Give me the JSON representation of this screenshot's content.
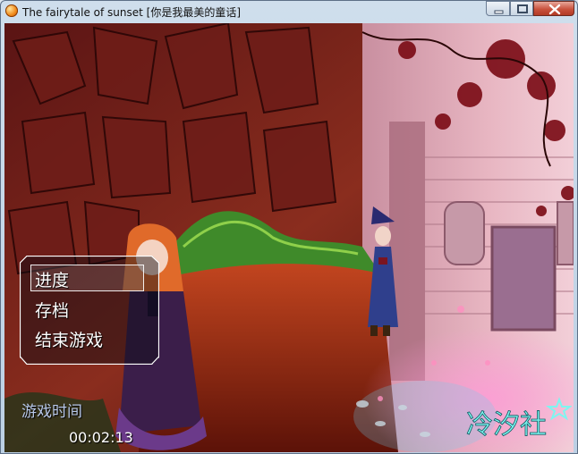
{
  "window": {
    "title": "The fairytale of sunset [你是我最美的童话]",
    "buttons": [
      "minimize",
      "maximize",
      "close"
    ]
  },
  "menu": {
    "items": [
      {
        "label": "进度",
        "selected": true
      },
      {
        "label": "存档",
        "selected": false
      },
      {
        "label": "结束游戏",
        "selected": false
      }
    ]
  },
  "playtime": {
    "label": "游戏时间",
    "value": "00:02:13"
  },
  "logo": {
    "text": "冷汐社"
  },
  "colors": {
    "accent_logo": "#7ff5f0",
    "menu_border": "#ffffff",
    "playtime_label": "#b9c9ea"
  }
}
